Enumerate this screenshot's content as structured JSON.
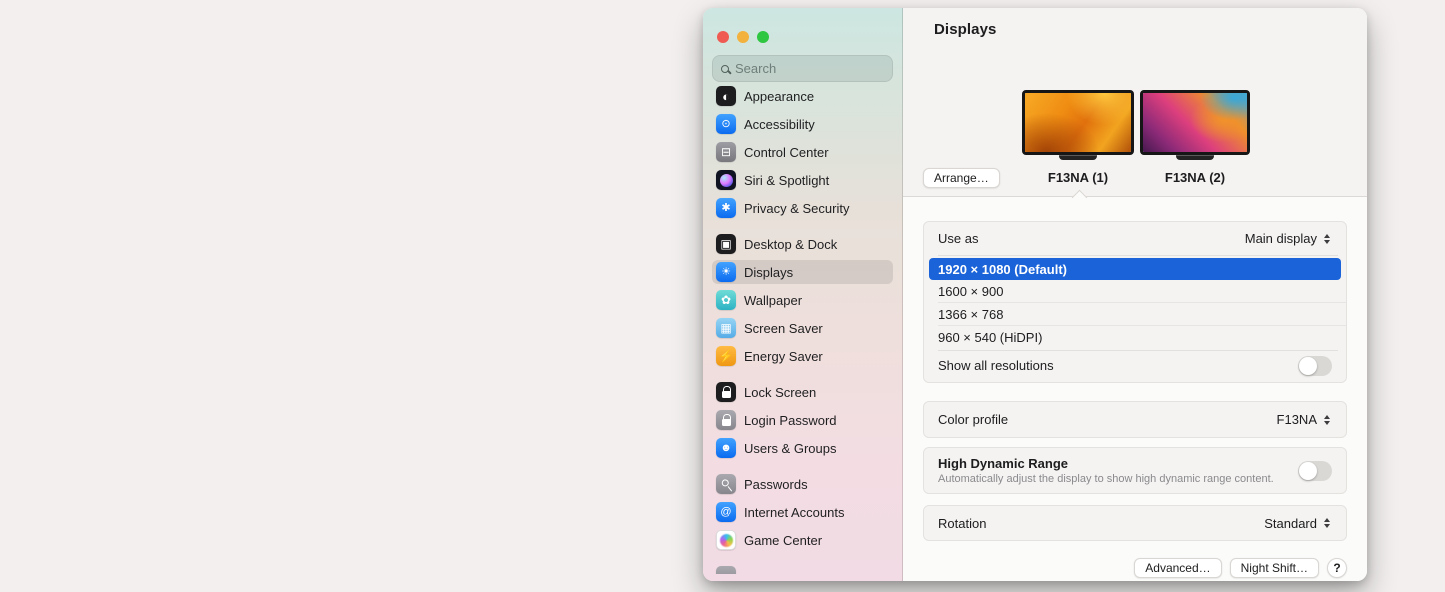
{
  "colors": {
    "selection_blue": "#1a63d8",
    "traffic_red": "#ef5b52",
    "traffic_yellow": "#f3b13d",
    "traffic_green": "#2fc641",
    "sidebar_top_tint": "#cde6e1",
    "sidebar_bottom_tint": "#f2dbe4"
  },
  "sidebar": {
    "search_placeholder": "Search",
    "groups": [
      {
        "items": [
          {
            "label": "Appearance"
          },
          {
            "label": "Accessibility"
          },
          {
            "label": "Control Center"
          },
          {
            "label": "Siri & Spotlight"
          },
          {
            "label": "Privacy & Security"
          }
        ]
      },
      {
        "items": [
          {
            "label": "Desktop & Dock"
          },
          {
            "label": "Displays",
            "selected": true
          },
          {
            "label": "Wallpaper"
          },
          {
            "label": "Screen Saver"
          },
          {
            "label": "Energy Saver"
          }
        ]
      },
      {
        "items": [
          {
            "label": "Lock Screen"
          },
          {
            "label": "Login Password"
          },
          {
            "label": "Users & Groups"
          }
        ]
      },
      {
        "items": [
          {
            "label": "Passwords"
          },
          {
            "label": "Internet Accounts"
          },
          {
            "label": "Game Center"
          }
        ]
      }
    ]
  },
  "main": {
    "title": "Displays",
    "arrange_label": "Arrange…",
    "displays": [
      {
        "name": "F13NA (1)"
      },
      {
        "name": "F13NA (2)"
      }
    ],
    "use_as": {
      "label": "Use as",
      "value": "Main display"
    },
    "resolutions": [
      {
        "label": "1920 × 1080 (Default)"
      },
      {
        "label": "1600 × 900"
      },
      {
        "label": "1366 × 768"
      },
      {
        "label": "960 × 540 (HiDPI)"
      }
    ],
    "selected_resolution_index": 0,
    "show_all_resolutions": {
      "label": "Show all resolutions",
      "state": "off"
    },
    "color_profile": {
      "label": "Color profile",
      "value": "F13NA"
    },
    "hdr": {
      "label": "High Dynamic Range",
      "description": "Automatically adjust the display to show high dynamic range content.",
      "state": "off"
    },
    "rotation": {
      "label": "Rotation",
      "value": "Standard"
    },
    "footer": {
      "advanced_label": "Advanced…",
      "night_shift_label": "Night Shift…",
      "help_label": "?"
    }
  }
}
